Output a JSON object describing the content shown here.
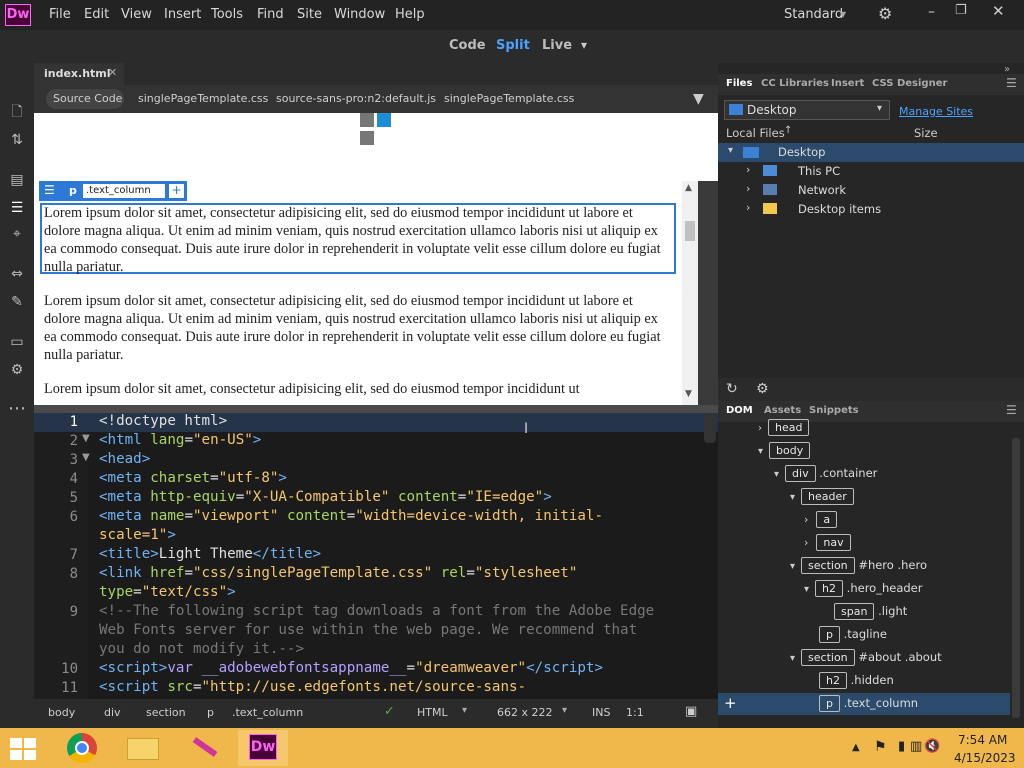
{
  "app": {
    "logo": "Dw",
    "menu": [
      "File",
      "Edit",
      "View",
      "Insert",
      "Tools",
      "Find",
      "Site",
      "Window",
      "Help"
    ],
    "workspace": "Standard"
  },
  "views": {
    "code": "Code",
    "split": "Split",
    "live": "Live"
  },
  "doc": {
    "tab": "index.html",
    "related": [
      "Source Code",
      "singlePageTemplate.css",
      "source-sans-pro:n2:default.js",
      "singlePageTemplate.css"
    ]
  },
  "design": {
    "tag": "p",
    "class_field": ".text_column",
    "paragraph": "Lorem ipsum dolor sit amet, consectetur adipisicing elit, sed do eiusmod tempor incididunt ut labore et dolore magna aliqua. Ut enim ad minim veniam, quis nostrud exercitation ullamco laboris nisi ut aliquip ex ea commodo consequat. Duis aute irure dolor in reprehenderit in voluptate velit esse cillum dolore eu fugiat nulla pariatur.",
    "partial": "Lorem ipsum dolor sit amet, consectetur adipisicing elit, sed do eiusmod tempor incididunt ut"
  },
  "code_lines": {
    "l1": "1",
    "l2": "2",
    "l3": "3",
    "l4": "4",
    "l5": "5",
    "l6": "6",
    "l7": "7",
    "l8": "8",
    "l9": "9",
    "l10": "10",
    "l11": "11"
  },
  "status": {
    "crumbs": [
      "body",
      "div",
      "section",
      "p",
      ".text_column"
    ],
    "lang": "HTML",
    "size": "662 x 222",
    "mode": "INS",
    "pos": "1:1"
  },
  "files": {
    "tabs": [
      "Files",
      "CC Libraries",
      "Insert",
      "CSS Designer"
    ],
    "site": "Desktop",
    "manage": "Manage Sites",
    "local": "Local Files",
    "size": "Size",
    "root": "Desktop",
    "items": [
      "This PC",
      "Network",
      "Desktop items"
    ]
  },
  "dom": {
    "tabs": [
      "DOM",
      "Assets",
      "Snippets"
    ],
    "rows": [
      {
        "tag": "head",
        "cls": ""
      },
      {
        "tag": "body",
        "cls": ""
      },
      {
        "tag": "div",
        "cls": ".container"
      },
      {
        "tag": "header",
        "cls": ""
      },
      {
        "tag": "a",
        "cls": ""
      },
      {
        "tag": "nav",
        "cls": ""
      },
      {
        "tag": "section",
        "cls": "#hero .hero"
      },
      {
        "tag": "h2",
        "cls": ".hero_header"
      },
      {
        "tag": "span",
        "cls": ".light"
      },
      {
        "tag": "p",
        "cls": ".tagline"
      },
      {
        "tag": "section",
        "cls": "#about .about"
      },
      {
        "tag": "h2",
        "cls": ".hidden"
      },
      {
        "tag": "p",
        "cls": ".text_column"
      }
    ]
  },
  "clock": {
    "time": "7:54 AM",
    "date": "4/15/2023"
  }
}
